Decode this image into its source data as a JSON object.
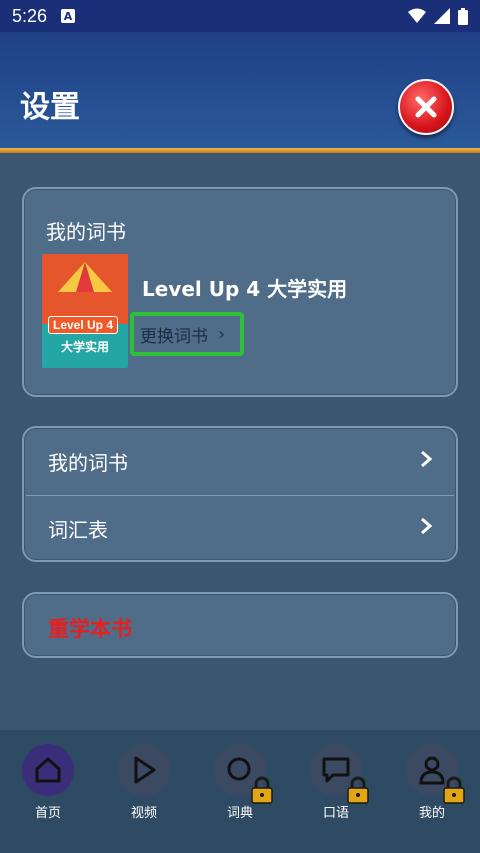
{
  "status_bar": {
    "time": "5:26",
    "notification_icon": "A"
  },
  "header": {
    "title": "设置",
    "close_icon": "close-icon"
  },
  "book_card": {
    "title": "我的词书",
    "book_name": "Level Up 4 大学实用",
    "cover_level": "Level Up 4",
    "cover_subtitle": "大学实用",
    "change_label": "更换词书"
  },
  "menu": {
    "items": [
      {
        "label": "我的词书"
      },
      {
        "label": "词汇表"
      }
    ]
  },
  "reset": {
    "label": "重学本书"
  },
  "tabs": [
    {
      "label": "首页",
      "icon": "home-icon",
      "locked": false
    },
    {
      "label": "视频",
      "icon": "play-icon",
      "locked": false
    },
    {
      "label": "词典",
      "icon": "search-icon",
      "locked": true
    },
    {
      "label": "口语",
      "icon": "chat-icon",
      "locked": true
    },
    {
      "label": "我的",
      "icon": "user-icon",
      "locked": true
    }
  ],
  "colors": {
    "accent_green": "#2fc03a",
    "reset_red": "#e52020",
    "header_blue": "#1f3f86",
    "orange_bar": "#f8b545"
  }
}
